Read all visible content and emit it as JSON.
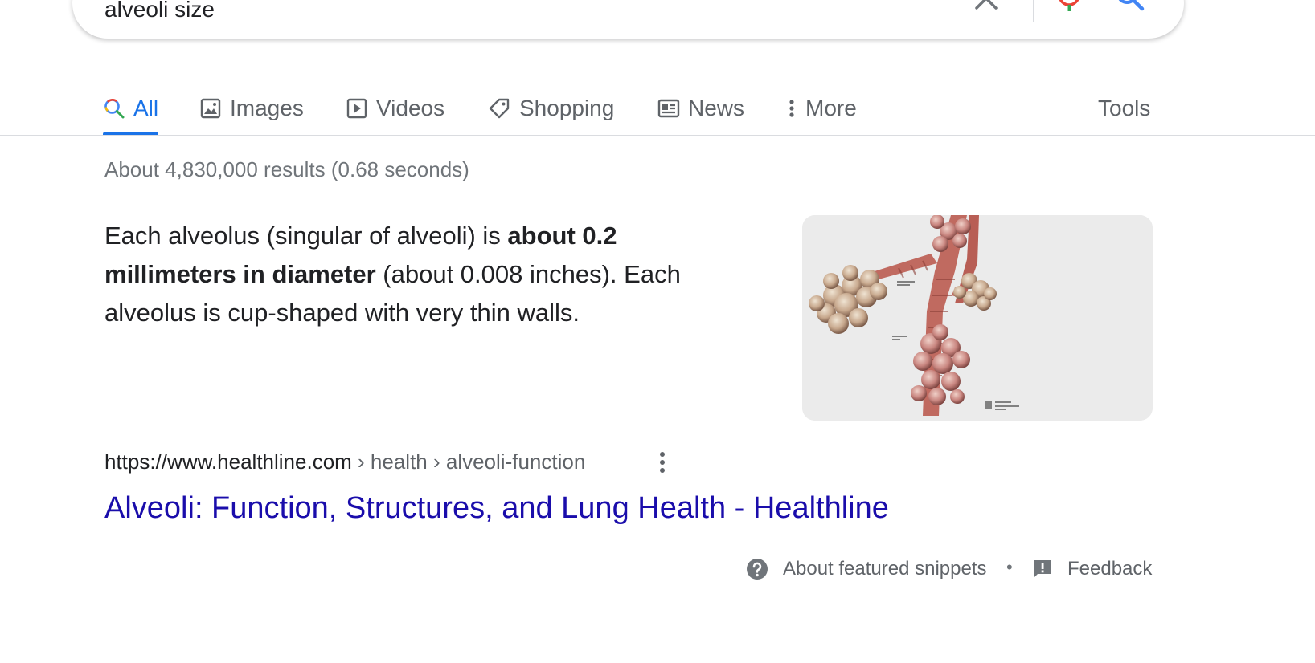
{
  "search": {
    "query": "alveoli size",
    "clear_icon": "close-icon",
    "mic_icon": "microphone-icon",
    "search_icon": "search-icon"
  },
  "tabs": [
    {
      "label": "All",
      "icon": "search-icon",
      "active": true
    },
    {
      "label": "Images",
      "icon": "image-icon"
    },
    {
      "label": "Videos",
      "icon": "video-icon"
    },
    {
      "label": "Shopping",
      "icon": "tag-icon"
    },
    {
      "label": "News",
      "icon": "newspaper-icon"
    },
    {
      "label": "More",
      "icon": "more-vert-icon"
    }
  ],
  "tools_label": "Tools",
  "result_stats": "About 4,830,000 results (0.68 seconds)",
  "snippet": {
    "text_before": "Each alveolus (singular of alveoli) is ",
    "text_bold": "about 0.2 millimeters in diameter",
    "text_after": " (about 0.008 inches). Each alveolus is cup-shaped with very thin walls."
  },
  "result": {
    "domain": "https://www.healthline.com",
    "breadcrumbs": " › health › alveoli-function",
    "title": "Alveoli: Function, Structures, and Lung Health - Healthline"
  },
  "footer": {
    "about_label": "About featured snippets",
    "separator": "•",
    "feedback_label": "Feedback"
  },
  "colors": {
    "accent": "#1a73e8",
    "link": "#1a0dab",
    "muted": "#5f6368"
  }
}
